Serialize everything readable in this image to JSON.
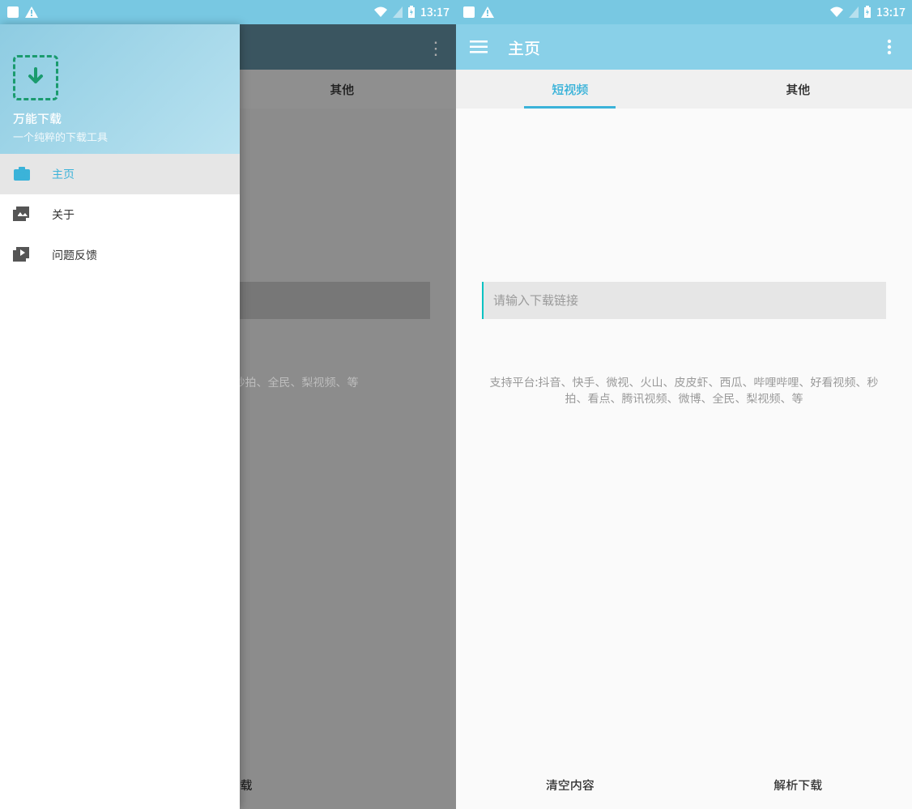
{
  "status": {
    "time": "13:17"
  },
  "appbar": {
    "title": "主页"
  },
  "tabs": {
    "short_video": "短视频",
    "other": "其他"
  },
  "input": {
    "placeholder": "请输入下载链接"
  },
  "platforms_full": "支持平台:抖音、快手、微视、火山、皮皮虾、西瓜、哔哩哔哩、好看视频、秒拍、看点、腾讯视频、微博、全民、梨视频、等",
  "platforms_partial": "、西瓜、哔哩哔哩、好看视频、秒拍、全民、梨视频、等",
  "footer": {
    "clear": "清空内容",
    "parse": "解析下载"
  },
  "drawer": {
    "app_name": "万能下载",
    "app_sub": "一个纯粹的下载工具",
    "items": [
      {
        "label": "主页"
      },
      {
        "label": "关于"
      },
      {
        "label": "问题反馈"
      }
    ]
  }
}
